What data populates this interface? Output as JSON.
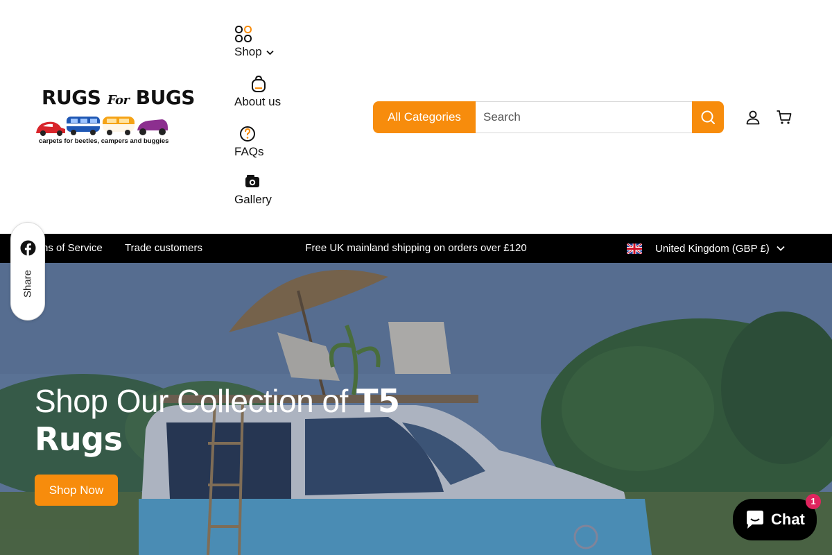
{
  "logo": {
    "title_rugs": "RUGS",
    "title_for": "For",
    "title_bugs": "BUGS",
    "tagline": "carpets for beetles, campers and buggies"
  },
  "nav": {
    "items": [
      {
        "label": "Shop",
        "icon": "grid-icon",
        "has_dropdown": true
      },
      {
        "label": "About us",
        "icon": "bag-icon"
      },
      {
        "label": "FAQs",
        "icon": "question-icon"
      },
      {
        "label": "Gallery",
        "icon": "camera-icon"
      }
    ]
  },
  "search": {
    "category_label": "All Categories",
    "placeholder": "Search",
    "value": ""
  },
  "header_icons": [
    "account-icon",
    "cart-icon"
  ],
  "announcement": {
    "links": [
      "Terms of Service",
      "Trade customers"
    ],
    "message": "Free UK mainland shipping on orders over £120",
    "country_label": "United Kingdom (GBP £)"
  },
  "hero": {
    "title_regular": "Shop Our Collection of ",
    "title_bold": "T5 Rugs",
    "button_label": "Shop Now"
  },
  "share": {
    "label": "Share",
    "icon": "facebook-icon"
  },
  "chat": {
    "label": "Chat",
    "badge_count": "1"
  },
  "colors": {
    "accent": "#f78c0c",
    "bar_background": "#000000",
    "chat_badge": "#e0245e"
  }
}
